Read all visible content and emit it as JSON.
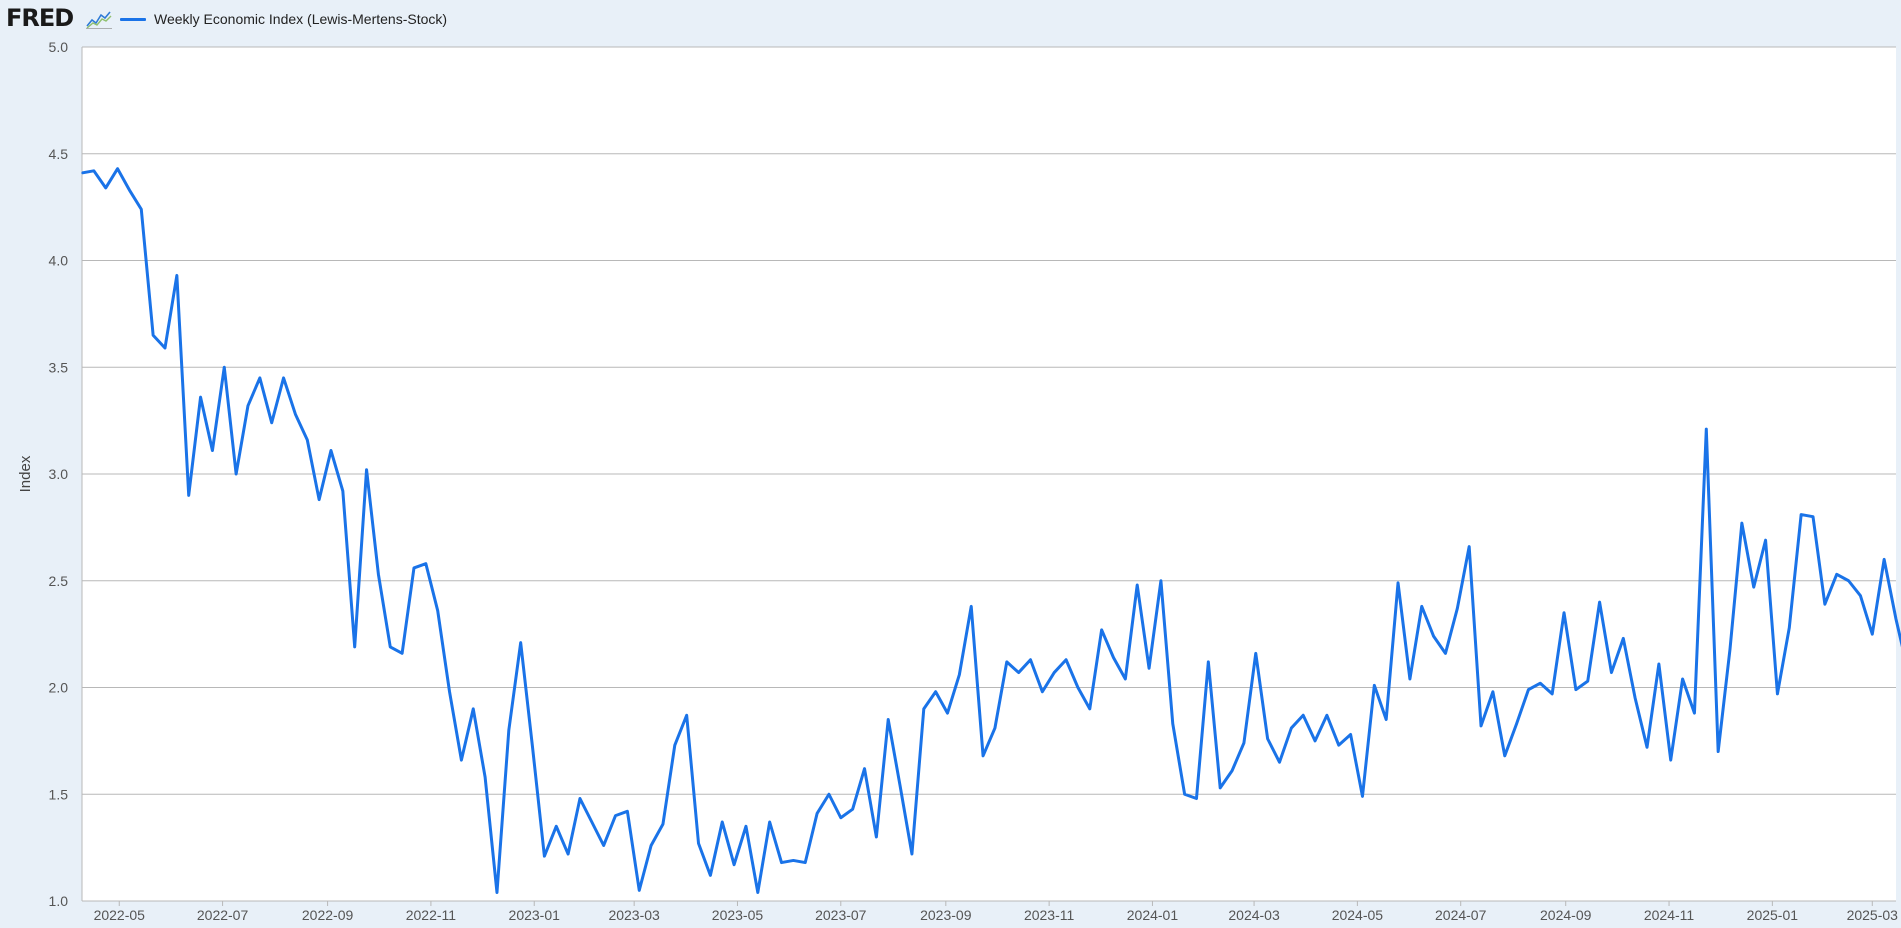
{
  "header": {
    "logo_text": "FRED",
    "logo_icon": "line-chart-icon",
    "legend_label": "Weekly Economic Index (Lewis-Mertens-Stock)"
  },
  "colors": {
    "series": "#1a73e8",
    "grid": "#b8b8b8",
    "plot_bg": "#ffffff",
    "page_bg": "#e8f0f8"
  },
  "chart_data": {
    "type": "line",
    "title": "",
    "xlabel": "",
    "ylabel": "Index",
    "ylim": [
      1.0,
      5.0
    ],
    "yticks": [
      "5.0",
      "4.5",
      "4.0",
      "3.5",
      "3.0",
      "2.5",
      "2.0",
      "1.5",
      "1.0"
    ],
    "xlim": [
      "2022-04-09",
      "2025-03-15"
    ],
    "xticks": [
      "2022-05",
      "2022-07",
      "2022-09",
      "2022-11",
      "2023-01",
      "2023-03",
      "2023-05",
      "2023-07",
      "2023-09",
      "2023-11",
      "2024-01",
      "2024-03",
      "2024-05",
      "2024-07",
      "2024-09",
      "2024-11",
      "2025-01",
      "2025-03"
    ],
    "grid": true,
    "legend": "top-left",
    "series": [
      {
        "name": "Weekly Economic Index (Lewis-Mertens-Stock)",
        "start": "2022-04-09",
        "interval_days": 7,
        "values": [
          4.41,
          4.42,
          4.34,
          4.43,
          4.33,
          4.24,
          3.65,
          3.59,
          3.93,
          2.9,
          3.36,
          3.11,
          3.5,
          3.0,
          3.32,
          3.45,
          3.24,
          3.45,
          3.28,
          3.16,
          2.88,
          3.11,
          2.92,
          2.19,
          3.02,
          2.53,
          2.19,
          2.16,
          2.56,
          2.58,
          2.36,
          1.98,
          1.66,
          1.9,
          1.58,
          1.04,
          1.8,
          2.21,
          1.72,
          1.21,
          1.35,
          1.22,
          1.48,
          1.37,
          1.26,
          1.4,
          1.42,
          1.05,
          1.26,
          1.36,
          1.73,
          1.87,
          1.27,
          1.12,
          1.37,
          1.17,
          1.35,
          1.04,
          1.37,
          1.18,
          1.19,
          1.18,
          1.41,
          1.5,
          1.39,
          1.43,
          1.62,
          1.3,
          1.85,
          1.54,
          1.22,
          1.9,
          1.98,
          1.88,
          2.06,
          2.38,
          1.68,
          1.81,
          2.12,
          2.07,
          2.13,
          1.98,
          2.07,
          2.13,
          2.0,
          1.9,
          2.27,
          2.14,
          2.04,
          2.48,
          2.09,
          2.5,
          1.83,
          1.5,
          1.48,
          2.12,
          1.53,
          1.61,
          1.74,
          2.16,
          1.76,
          1.65,
          1.81,
          1.87,
          1.75,
          1.87,
          1.73,
          1.78,
          1.49,
          2.01,
          1.85,
          2.49,
          2.04,
          2.38,
          2.24,
          2.16,
          2.37,
          2.66,
          1.82,
          1.98,
          1.68,
          1.83,
          1.99,
          2.02,
          1.97,
          2.35,
          1.99,
          2.03,
          2.4,
          2.07,
          2.23,
          1.95,
          1.72,
          2.11,
          1.66,
          2.04,
          1.88,
          3.21,
          1.7,
          2.18,
          2.77,
          2.47,
          2.69,
          1.97,
          2.28,
          2.81,
          2.8,
          2.39,
          2.53,
          2.5,
          2.43,
          2.25,
          2.6,
          2.32,
          2.08
        ]
      }
    ]
  }
}
